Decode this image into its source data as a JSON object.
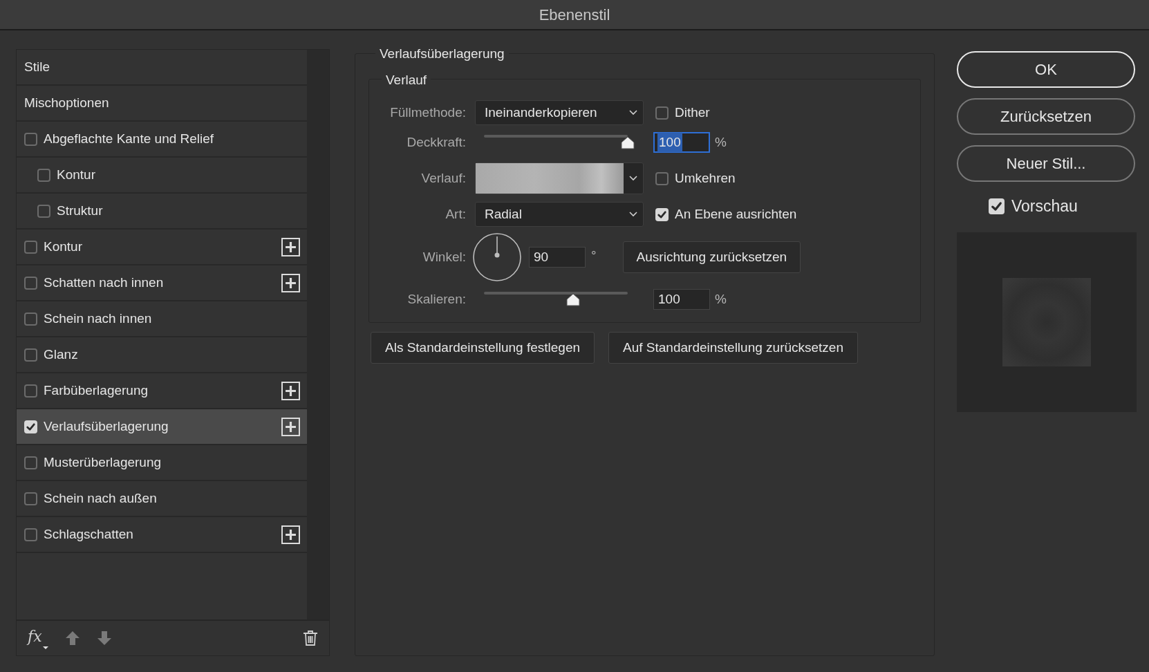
{
  "window": {
    "title": "Ebenenstil"
  },
  "styles_list": {
    "items": [
      {
        "kind": "header",
        "label": "Stile",
        "selected": false
      },
      {
        "kind": "header",
        "label": "Mischoptionen",
        "selected": false
      },
      {
        "kind": "effect",
        "label": "Abgeflachte Kante und Relief",
        "checked": false,
        "selected": false,
        "add_button": false,
        "children": [
          {
            "kind": "effect",
            "label": "Kontur",
            "checked": false,
            "selected": false,
            "add_button": false
          },
          {
            "kind": "effect",
            "label": "Struktur",
            "checked": false,
            "selected": false,
            "add_button": false
          }
        ]
      },
      {
        "kind": "effect",
        "label": "Kontur",
        "checked": false,
        "selected": false,
        "add_button": true
      },
      {
        "kind": "effect",
        "label": "Schatten nach innen",
        "checked": false,
        "selected": false,
        "add_button": true
      },
      {
        "kind": "effect",
        "label": "Schein nach innen",
        "checked": false,
        "selected": false,
        "add_button": false
      },
      {
        "kind": "effect",
        "label": "Glanz",
        "checked": false,
        "selected": false,
        "add_button": false
      },
      {
        "kind": "effect",
        "label": "Farbüberlagerung",
        "checked": false,
        "selected": false,
        "add_button": true
      },
      {
        "kind": "effect",
        "label": "Verlaufsüberlagerung",
        "checked": true,
        "selected": true,
        "add_button": true
      },
      {
        "kind": "effect",
        "label": "Musterüberlagerung",
        "checked": false,
        "selected": false,
        "add_button": false
      },
      {
        "kind": "effect",
        "label": "Schein nach außen",
        "checked": false,
        "selected": false,
        "add_button": false
      },
      {
        "kind": "effect",
        "label": "Schlagschatten",
        "checked": false,
        "selected": false,
        "add_button": true
      }
    ],
    "toolbar": {
      "fx_label": "fx"
    }
  },
  "panel": {
    "title": "Verlaufsüberlagerung",
    "group": {
      "title": "Verlauf",
      "fill_method": {
        "label": "Füllmethode:",
        "value": "Ineinanderkopieren"
      },
      "dither": {
        "label": "Dither",
        "checked": false
      },
      "opacity": {
        "label": "Deckkraft:",
        "level": 1.0,
        "value": "100",
        "unit": "%",
        "focused": true
      },
      "gradient": {
        "label": "Verlauf:"
      },
      "reverse": {
        "label": "Umkehren",
        "checked": false
      },
      "style": {
        "label": "Art:",
        "value": "Radial"
      },
      "align_with_layer": {
        "label": "An Ebene ausrichten",
        "checked": true
      },
      "angle": {
        "label": "Winkel:",
        "value": "90",
        "unit": "°"
      },
      "reset_alignment_button": "Ausrichtung zurücksetzen",
      "scale": {
        "label": "Skalieren:",
        "level": 0.62,
        "value": "100",
        "unit": "%",
        "focused": false
      }
    },
    "buttons": [
      "Als Standardeinstellung festlegen",
      "Auf Standardeinstellung zurücksetzen"
    ]
  },
  "side": {
    "buttons": [
      {
        "label": "OK",
        "default": true
      },
      {
        "label": "Zurücksetzen",
        "default": false
      },
      {
        "label": "Neuer Stil...",
        "default": false
      }
    ],
    "preview": {
      "label": "Vorschau",
      "checked": true
    }
  }
}
